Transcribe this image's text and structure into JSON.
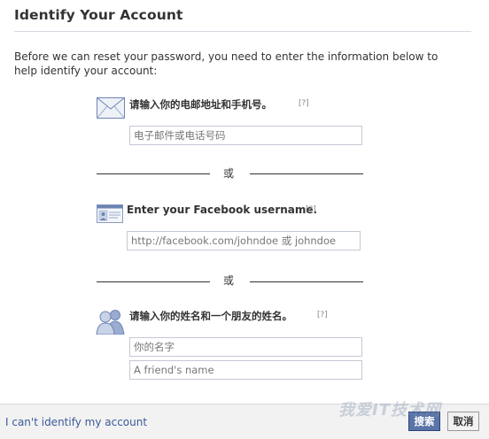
{
  "header": {
    "title": "Identify Your Account"
  },
  "intro": "Before we can reset your password, you need to enter the information below to help identify your account:",
  "email_section": {
    "label": "请输入你的电邮地址和手机号。",
    "help": "[?]",
    "placeholder": "电子邮件或电话号码",
    "icon": "envelope-icon"
  },
  "divider1": "或",
  "username_section": {
    "label": "Enter your Facebook username.",
    "help": "[?]",
    "placeholder": "http://facebook.com/johndoe 或 johndoe",
    "icon": "id-card-icon"
  },
  "divider2": "或",
  "name_section": {
    "label": "请输入你的姓名和一个朋友的姓名。",
    "help": "[?]",
    "your_name_placeholder": "你的名字",
    "friend_name_placeholder": "A friend's name",
    "icon": "friends-icon"
  },
  "footer": {
    "cant_identify": "I can't identify my account",
    "search_button": "搜索",
    "cancel_button": "取消"
  },
  "watermark": "我爱IT技术网",
  "colors": {
    "link": "#3b5998",
    "primary_button": "#5b74a8",
    "border": "#c4c9d4"
  }
}
